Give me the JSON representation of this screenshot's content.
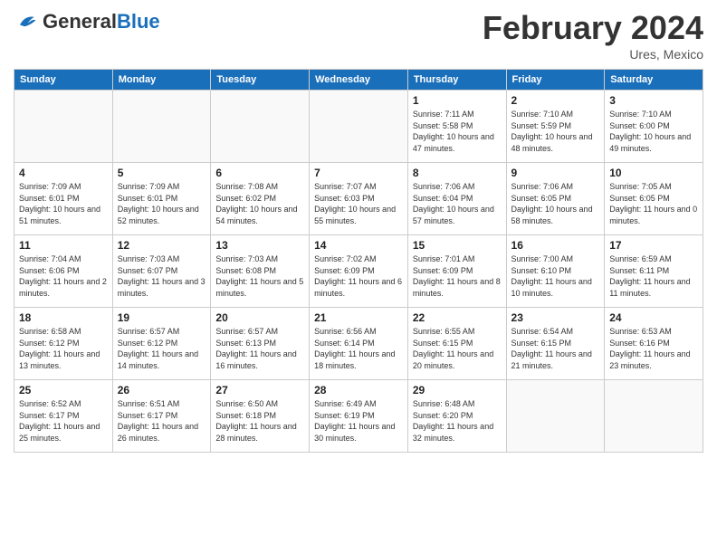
{
  "header": {
    "logo_general": "General",
    "logo_blue": "Blue",
    "month_title": "February 2024",
    "subtitle": "Ures, Mexico"
  },
  "weekdays": [
    "Sunday",
    "Monday",
    "Tuesday",
    "Wednesday",
    "Thursday",
    "Friday",
    "Saturday"
  ],
  "weeks": [
    [
      {
        "day": "",
        "empty": true
      },
      {
        "day": "",
        "empty": true
      },
      {
        "day": "",
        "empty": true
      },
      {
        "day": "",
        "empty": true
      },
      {
        "day": "1",
        "sunrise": "Sunrise: 7:11 AM",
        "sunset": "Sunset: 5:58 PM",
        "daylight": "Daylight: 10 hours and 47 minutes."
      },
      {
        "day": "2",
        "sunrise": "Sunrise: 7:10 AM",
        "sunset": "Sunset: 5:59 PM",
        "daylight": "Daylight: 10 hours and 48 minutes."
      },
      {
        "day": "3",
        "sunrise": "Sunrise: 7:10 AM",
        "sunset": "Sunset: 6:00 PM",
        "daylight": "Daylight: 10 hours and 49 minutes."
      }
    ],
    [
      {
        "day": "4",
        "sunrise": "Sunrise: 7:09 AM",
        "sunset": "Sunset: 6:01 PM",
        "daylight": "Daylight: 10 hours and 51 minutes."
      },
      {
        "day": "5",
        "sunrise": "Sunrise: 7:09 AM",
        "sunset": "Sunset: 6:01 PM",
        "daylight": "Daylight: 10 hours and 52 minutes."
      },
      {
        "day": "6",
        "sunrise": "Sunrise: 7:08 AM",
        "sunset": "Sunset: 6:02 PM",
        "daylight": "Daylight: 10 hours and 54 minutes."
      },
      {
        "day": "7",
        "sunrise": "Sunrise: 7:07 AM",
        "sunset": "Sunset: 6:03 PM",
        "daylight": "Daylight: 10 hours and 55 minutes."
      },
      {
        "day": "8",
        "sunrise": "Sunrise: 7:06 AM",
        "sunset": "Sunset: 6:04 PM",
        "daylight": "Daylight: 10 hours and 57 minutes."
      },
      {
        "day": "9",
        "sunrise": "Sunrise: 7:06 AM",
        "sunset": "Sunset: 6:05 PM",
        "daylight": "Daylight: 10 hours and 58 minutes."
      },
      {
        "day": "10",
        "sunrise": "Sunrise: 7:05 AM",
        "sunset": "Sunset: 6:05 PM",
        "daylight": "Daylight: 11 hours and 0 minutes."
      }
    ],
    [
      {
        "day": "11",
        "sunrise": "Sunrise: 7:04 AM",
        "sunset": "Sunset: 6:06 PM",
        "daylight": "Daylight: 11 hours and 2 minutes."
      },
      {
        "day": "12",
        "sunrise": "Sunrise: 7:03 AM",
        "sunset": "Sunset: 6:07 PM",
        "daylight": "Daylight: 11 hours and 3 minutes."
      },
      {
        "day": "13",
        "sunrise": "Sunrise: 7:03 AM",
        "sunset": "Sunset: 6:08 PM",
        "daylight": "Daylight: 11 hours and 5 minutes."
      },
      {
        "day": "14",
        "sunrise": "Sunrise: 7:02 AM",
        "sunset": "Sunset: 6:09 PM",
        "daylight": "Daylight: 11 hours and 6 minutes."
      },
      {
        "day": "15",
        "sunrise": "Sunrise: 7:01 AM",
        "sunset": "Sunset: 6:09 PM",
        "daylight": "Daylight: 11 hours and 8 minutes."
      },
      {
        "day": "16",
        "sunrise": "Sunrise: 7:00 AM",
        "sunset": "Sunset: 6:10 PM",
        "daylight": "Daylight: 11 hours and 10 minutes."
      },
      {
        "day": "17",
        "sunrise": "Sunrise: 6:59 AM",
        "sunset": "Sunset: 6:11 PM",
        "daylight": "Daylight: 11 hours and 11 minutes."
      }
    ],
    [
      {
        "day": "18",
        "sunrise": "Sunrise: 6:58 AM",
        "sunset": "Sunset: 6:12 PM",
        "daylight": "Daylight: 11 hours and 13 minutes."
      },
      {
        "day": "19",
        "sunrise": "Sunrise: 6:57 AM",
        "sunset": "Sunset: 6:12 PM",
        "daylight": "Daylight: 11 hours and 14 minutes."
      },
      {
        "day": "20",
        "sunrise": "Sunrise: 6:57 AM",
        "sunset": "Sunset: 6:13 PM",
        "daylight": "Daylight: 11 hours and 16 minutes."
      },
      {
        "day": "21",
        "sunrise": "Sunrise: 6:56 AM",
        "sunset": "Sunset: 6:14 PM",
        "daylight": "Daylight: 11 hours and 18 minutes."
      },
      {
        "day": "22",
        "sunrise": "Sunrise: 6:55 AM",
        "sunset": "Sunset: 6:15 PM",
        "daylight": "Daylight: 11 hours and 20 minutes."
      },
      {
        "day": "23",
        "sunrise": "Sunrise: 6:54 AM",
        "sunset": "Sunset: 6:15 PM",
        "daylight": "Daylight: 11 hours and 21 minutes."
      },
      {
        "day": "24",
        "sunrise": "Sunrise: 6:53 AM",
        "sunset": "Sunset: 6:16 PM",
        "daylight": "Daylight: 11 hours and 23 minutes."
      }
    ],
    [
      {
        "day": "25",
        "sunrise": "Sunrise: 6:52 AM",
        "sunset": "Sunset: 6:17 PM",
        "daylight": "Daylight: 11 hours and 25 minutes."
      },
      {
        "day": "26",
        "sunrise": "Sunrise: 6:51 AM",
        "sunset": "Sunset: 6:17 PM",
        "daylight": "Daylight: 11 hours and 26 minutes."
      },
      {
        "day": "27",
        "sunrise": "Sunrise: 6:50 AM",
        "sunset": "Sunset: 6:18 PM",
        "daylight": "Daylight: 11 hours and 28 minutes."
      },
      {
        "day": "28",
        "sunrise": "Sunrise: 6:49 AM",
        "sunset": "Sunset: 6:19 PM",
        "daylight": "Daylight: 11 hours and 30 minutes."
      },
      {
        "day": "29",
        "sunrise": "Sunrise: 6:48 AM",
        "sunset": "Sunset: 6:20 PM",
        "daylight": "Daylight: 11 hours and 32 minutes."
      },
      {
        "day": "",
        "empty": true
      },
      {
        "day": "",
        "empty": true
      }
    ]
  ]
}
